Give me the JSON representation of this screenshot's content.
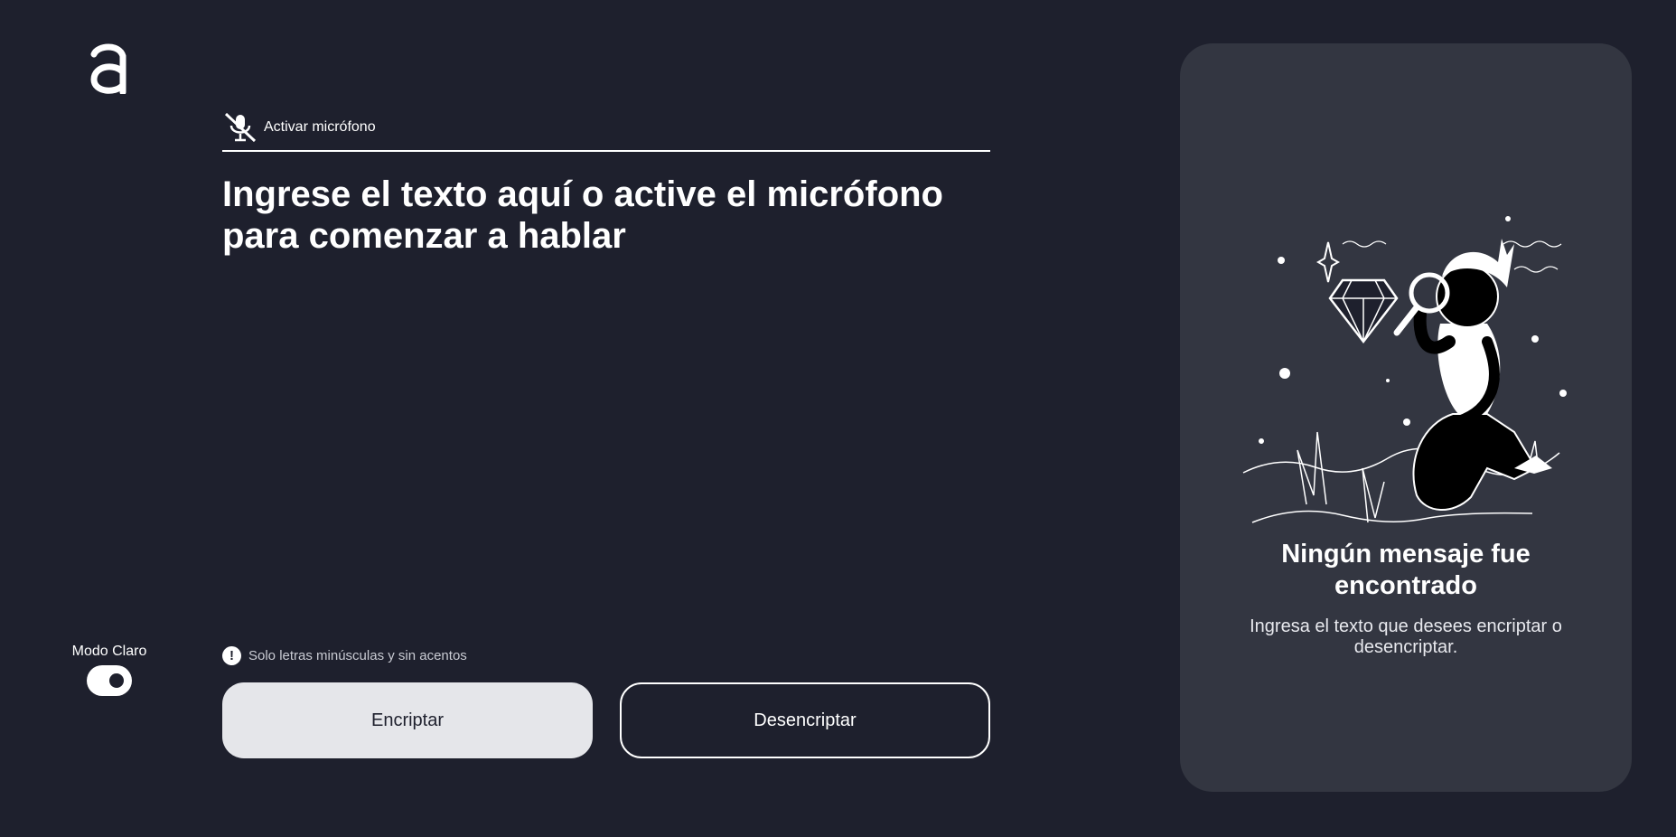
{
  "logo": {
    "icon": "letter-a-logo-icon"
  },
  "microphone": {
    "label": "Activar micrófono",
    "icon": "microphone-off-icon"
  },
  "input": {
    "placeholder": "Ingrese el texto aquí o active el micrófono para comenzar a hablar"
  },
  "theme": {
    "label": "Modo Claro",
    "icon": "toggle-switch"
  },
  "hint": {
    "icon": "exclamation-icon",
    "icon_char": "!",
    "text": "Solo letras minúsculas y sin acentos"
  },
  "actions": {
    "encrypt_label": "Encriptar",
    "decrypt_label": "Desencriptar"
  },
  "result": {
    "illustration": "magnifier-search-illustration",
    "title": "Ningún mensaje fue encontrado",
    "subtitle": "Ingresa el texto que desees encriptar o desencriptar."
  },
  "colors": {
    "background": "#1e202d",
    "panel": "#333641",
    "primary_button": "#e5e6ea",
    "text": "#ffffff"
  }
}
